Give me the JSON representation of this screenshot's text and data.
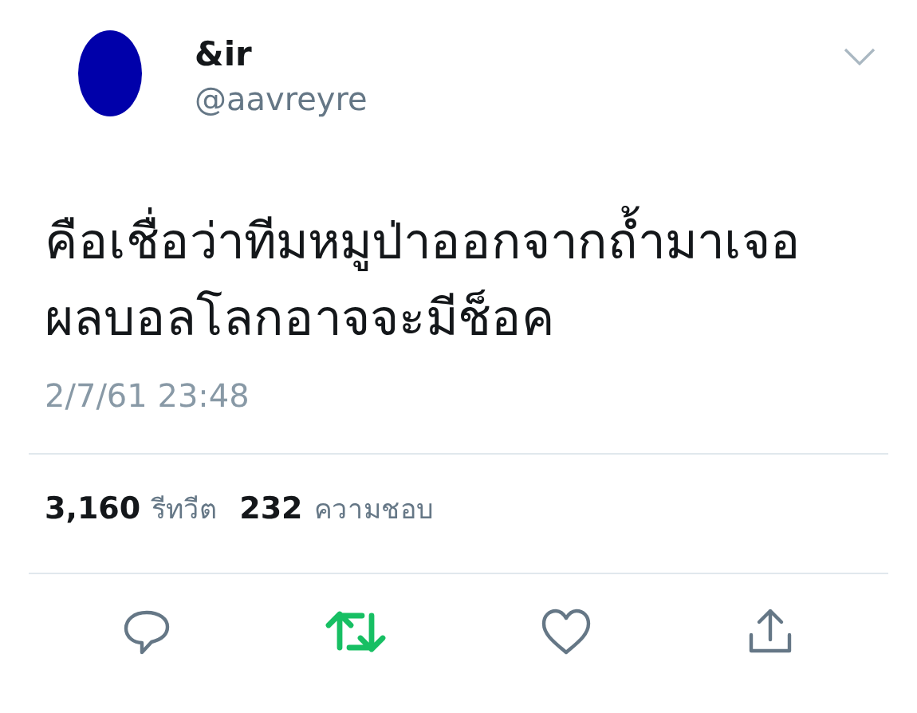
{
  "author": {
    "name": "&ir",
    "handle": "@aavreyre"
  },
  "tweet": {
    "text_lines": [
      "คือเชื่อว่าทีมหมูป่าออกจากถ้ำมาเจอ",
      "ผลบอลโลกอาจจะมีช็อค"
    ],
    "date": "2/7/61 23:48"
  },
  "stats": [
    {
      "count": "3,160",
      "label": "รีทวีต"
    },
    {
      "count": "232",
      "label": "ความชอบ"
    }
  ],
  "actions": [
    {
      "kind": "reply",
      "on": false
    },
    {
      "kind": "retweet",
      "on": true
    },
    {
      "kind": "like",
      "on": false
    },
    {
      "kind": "share",
      "on": false
    }
  ]
}
